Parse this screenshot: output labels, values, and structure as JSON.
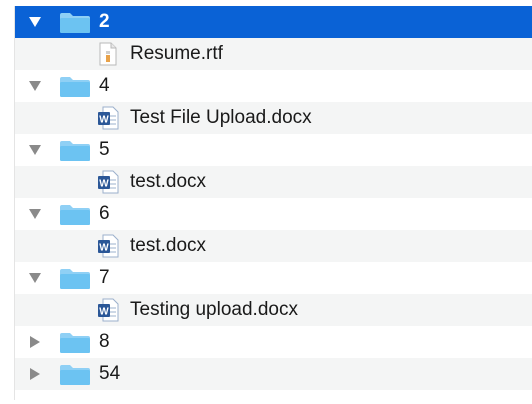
{
  "tree": [
    {
      "type": "folder",
      "name": "2",
      "expanded": true,
      "selected": true
    },
    {
      "type": "file",
      "name": "Resume.rtf",
      "icon": "rtf-document-icon"
    },
    {
      "type": "folder",
      "name": "4",
      "expanded": true
    },
    {
      "type": "file",
      "name": "Test File Upload.docx",
      "icon": "word-document-icon"
    },
    {
      "type": "folder",
      "name": "5",
      "expanded": true
    },
    {
      "type": "file",
      "name": "test.docx",
      "icon": "word-document-icon"
    },
    {
      "type": "folder",
      "name": "6",
      "expanded": true
    },
    {
      "type": "file",
      "name": "test.docx",
      "icon": "word-document-icon"
    },
    {
      "type": "folder",
      "name": "7",
      "expanded": true
    },
    {
      "type": "file",
      "name": "Testing upload.docx",
      "icon": "word-document-icon"
    },
    {
      "type": "folder",
      "name": "8",
      "expanded": false
    },
    {
      "type": "folder",
      "name": "54",
      "expanded": false
    }
  ],
  "colors": {
    "selection": "#0a62d6",
    "stripe": "#f4f5f5",
    "folder": "#6cc3f2",
    "word_blue": "#2b5797"
  }
}
